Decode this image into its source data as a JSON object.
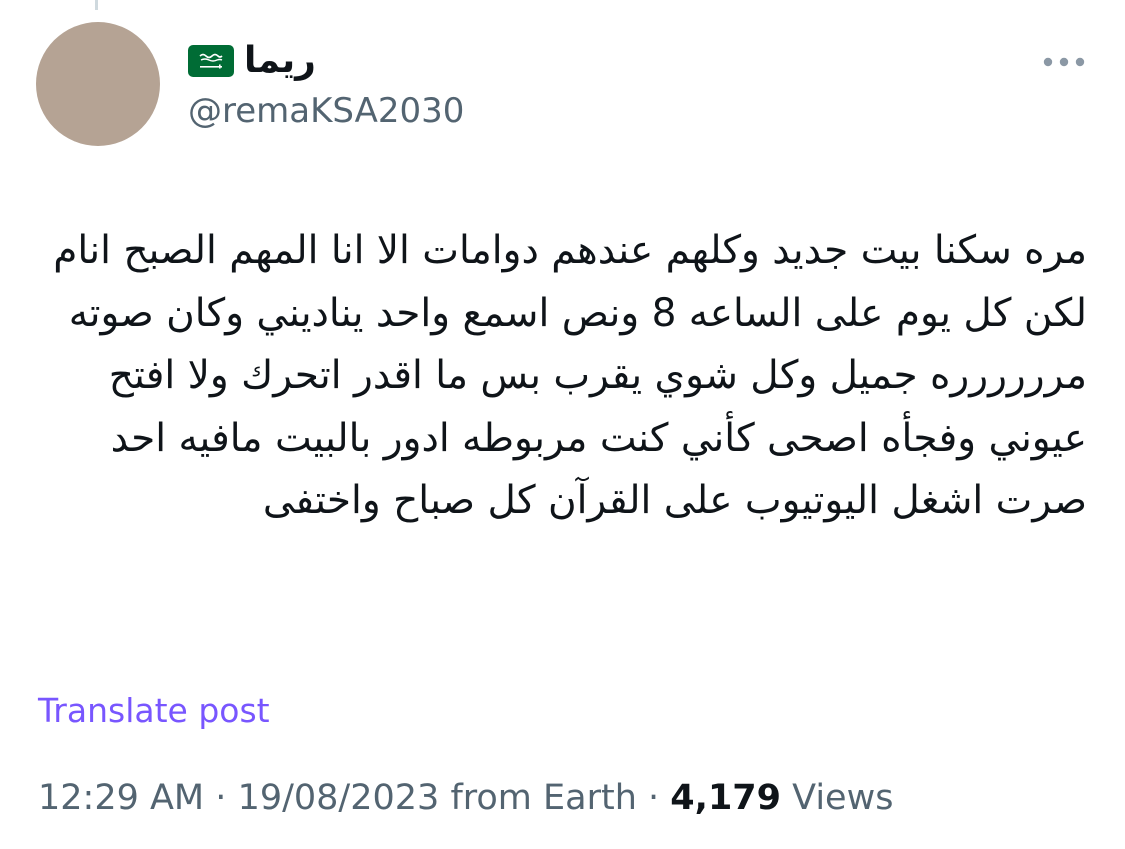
{
  "author": {
    "display_name": "ريما",
    "handle": "@remaKSA2030",
    "flag_icon": "saudi-arabia-flag-icon",
    "avatar_color": "#b5a394"
  },
  "menu": {
    "more_icon": "more-horizontal-icon"
  },
  "post": {
    "text": "مره سكنا بيت جديد وكلهم عندهم دوامات الا انا المهم الصبح انام لكن كل يوم على الساعه 8 ونص اسمع واحد يناديني وكان صوته مرررررره جميل وكل شوي يقرب بس ما اقدر اتحرك ولا افتح عيوني وفجأه اصحى كأني كنت مربوطه ادور بالبيت مافيه احد صرت اشغل اليوتيوب على القرآن كل صباح واختفى",
    "translate_label": "Translate post"
  },
  "meta": {
    "time": "12:29 AM",
    "separator": "·",
    "date": "19/08/2023",
    "source": "from Earth",
    "views_count": "4,179",
    "views_label": "Views"
  },
  "colors": {
    "accent": "#7856ff",
    "secondary_text": "#536471",
    "primary_text": "#0f1419",
    "flag_green": "#006c35"
  }
}
